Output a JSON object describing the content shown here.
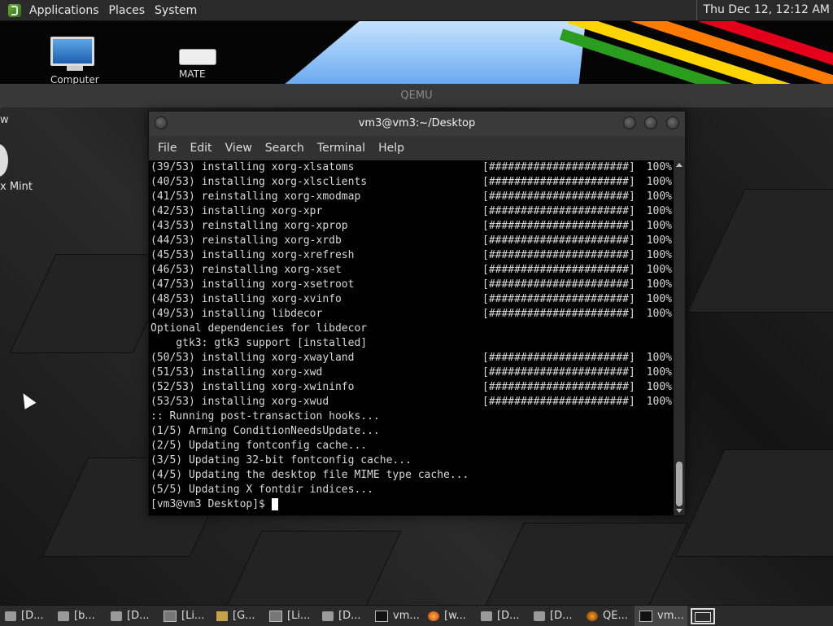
{
  "top_panel": {
    "menus": [
      "Applications",
      "Places",
      "System"
    ],
    "clock": "Thu Dec 12, 12:12 AM"
  },
  "host_desktop": {
    "icon_computer_label": "Computer",
    "icon_drive_label": "MATE"
  },
  "qemu": {
    "title": "QEMU"
  },
  "vm_desktop": {
    "top_text": "w",
    "mint_label": "x Mint"
  },
  "terminal": {
    "title": "vm3@vm3:~/Desktop",
    "menu": [
      "File",
      "Edit",
      "View",
      "Search",
      "Terminal",
      "Help"
    ],
    "lines": [
      {
        "text": "(39/53) installing xorg-xlsatoms",
        "bar": "[######################]",
        "pct": "100%"
      },
      {
        "text": "(40/53) installing xorg-xlsclients",
        "bar": "[######################]",
        "pct": "100%"
      },
      {
        "text": "(41/53) reinstalling xorg-xmodmap",
        "bar": "[######################]",
        "pct": "100%"
      },
      {
        "text": "(42/53) installing xorg-xpr",
        "bar": "[######################]",
        "pct": "100%"
      },
      {
        "text": "(43/53) reinstalling xorg-xprop",
        "bar": "[######################]",
        "pct": "100%"
      },
      {
        "text": "(44/53) reinstalling xorg-xrdb",
        "bar": "[######################]",
        "pct": "100%"
      },
      {
        "text": "(45/53) installing xorg-xrefresh",
        "bar": "[######################]",
        "pct": "100%"
      },
      {
        "text": "(46/53) reinstalling xorg-xset",
        "bar": "[######################]",
        "pct": "100%"
      },
      {
        "text": "(47/53) installing xorg-xsetroot",
        "bar": "[######################]",
        "pct": "100%"
      },
      {
        "text": "(48/53) installing xorg-xvinfo",
        "bar": "[######################]",
        "pct": "100%"
      },
      {
        "text": "(49/53) installing libdecor",
        "bar": "[######################]",
        "pct": "100%"
      },
      {
        "text": "Optional dependencies for libdecor",
        "bar": "",
        "pct": ""
      },
      {
        "text": "    gtk3: gtk3 support [installed]",
        "bar": "",
        "pct": ""
      },
      {
        "text": "(50/53) installing xorg-xwayland",
        "bar": "[######################]",
        "pct": "100%"
      },
      {
        "text": "(51/53) installing xorg-xwd",
        "bar": "[######################]",
        "pct": "100%"
      },
      {
        "text": "(52/53) installing xorg-xwininfo",
        "bar": "[######################]",
        "pct": "100%"
      },
      {
        "text": "(53/53) installing xorg-xwud",
        "bar": "[######################]",
        "pct": "100%"
      },
      {
        "text": ":: Running post-transaction hooks...",
        "bar": "",
        "pct": ""
      },
      {
        "text": "(1/5) Arming ConditionNeedsUpdate...",
        "bar": "",
        "pct": ""
      },
      {
        "text": "(2/5) Updating fontconfig cache...",
        "bar": "",
        "pct": ""
      },
      {
        "text": "(3/5) Updating 32-bit fontconfig cache...",
        "bar": "",
        "pct": ""
      },
      {
        "text": "(4/5) Updating the desktop file MIME type cache...",
        "bar": "",
        "pct": ""
      },
      {
        "text": "(5/5) Updating X fontdir indices...",
        "bar": "",
        "pct": ""
      }
    ],
    "prompt": "[vm3@vm3 Desktop]$ "
  },
  "taskbar": {
    "items": [
      {
        "label": "[D...",
        "icon": "folder-icon"
      },
      {
        "label": "[b...",
        "icon": "folder-icon"
      },
      {
        "label": "[D...",
        "icon": "folder-icon"
      },
      {
        "label": "[Li...",
        "icon": "image-icon"
      },
      {
        "label": "[G...",
        "icon": "box-icon"
      },
      {
        "label": "[Li...",
        "icon": "image-icon"
      },
      {
        "label": "[D...",
        "icon": "folder-icon"
      },
      {
        "label": "vm...",
        "icon": "terminal-icon"
      },
      {
        "label": "[w...",
        "icon": "firefox-icon"
      },
      {
        "label": "[D...",
        "icon": "folder-icon"
      },
      {
        "label": "[D...",
        "icon": "folder-icon"
      },
      {
        "label": "QE...",
        "icon": "qemu-icon"
      },
      {
        "label": "vm...",
        "icon": "terminal-icon"
      }
    ]
  }
}
